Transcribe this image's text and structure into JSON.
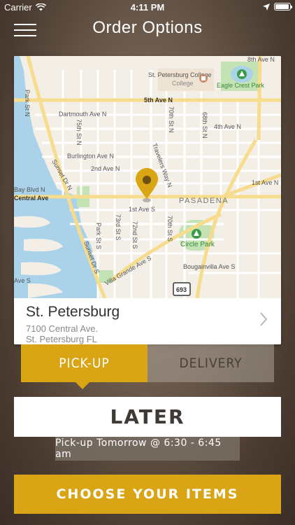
{
  "status": {
    "carrier": "Carrier",
    "time": "4:11 PM"
  },
  "header": {
    "title": "Order Options"
  },
  "map": {
    "labels": {
      "st_pete_college": "St. Petersburg College",
      "st_pete_college_2": "College",
      "eagle_crest": "Eagle Crest Park",
      "ave_8th": "8th Ave N",
      "ave_5th": "5th Ave N",
      "ave_4th": "4th Ave N",
      "ave_2nd": "2nd Ave N",
      "ave_1st": "1st Ave N",
      "dartmouth": "Dartmouth Ave N",
      "burlington": "Burlington Ave N",
      "park_st": "Park St N",
      "st_75th": "75th St N",
      "st_70th": "70th St N",
      "st_68th": "68th St N",
      "travelers": "Travelers Way N",
      "sunset": "Sunset Dr N",
      "bay_blvd": "Bay Blvd N",
      "central": "Central Ave",
      "pasadena": "PASADENA",
      "ave_1st_s": "1st Ave S",
      "park_st_s": "Park St S",
      "st_73rd_s": "73rd St S",
      "st_72nd_s": "72nd St S",
      "st_70th_s": "70th St S",
      "sunset_s": "Sunset Dr S",
      "villa_grande": "Villa Grande Ave S",
      "circle_park": "Circle Park",
      "bougainvilla": "Bougainvilla Ave S",
      "route": "693",
      "ave_s": "Ave S"
    }
  },
  "location": {
    "name": "St. Petersburg",
    "address_line1": "7100 Central Ave.",
    "address_line2": "St. Petersburg FL"
  },
  "order_type": {
    "pickup_label": "PICK-UP",
    "delivery_label": "DELIVERY",
    "selected": "pickup"
  },
  "timing": {
    "later_label": "LATER",
    "pickup_time": "Pick-up Tomorrow @ 6:30 - 6:45 am"
  },
  "cta": {
    "choose_label": "CHOOSE YOUR ITEMS"
  },
  "colors": {
    "accent": "#d9a514",
    "map_bg": "#f3efe6",
    "water": "#aad3ea",
    "park": "#c4e3b4"
  }
}
